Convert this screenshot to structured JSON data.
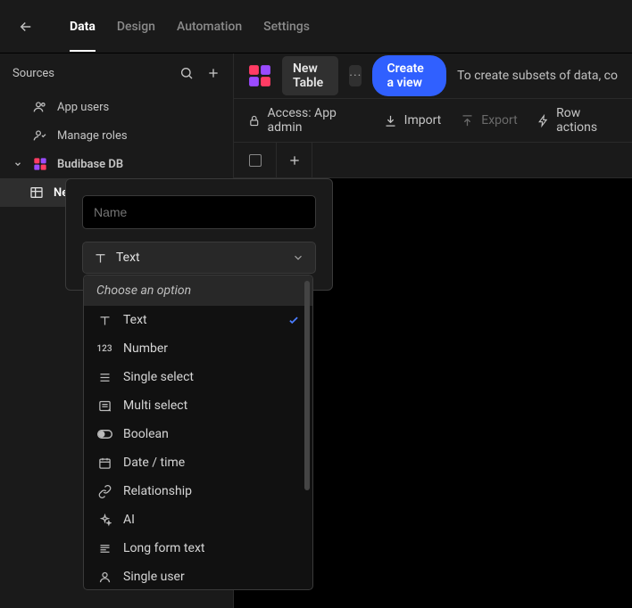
{
  "nav": {
    "tabs": [
      "Data",
      "Design",
      "Automation",
      "Settings"
    ],
    "active": 0
  },
  "sidebar": {
    "title": "Sources",
    "items": {
      "app_users": "App users",
      "manage_roles": "Manage roles",
      "db": "Budibase DB",
      "new_table": "New Table"
    }
  },
  "content": {
    "table_name": "New Table",
    "create_view": "Create a view",
    "hint": "To create subsets of data, co"
  },
  "toolbar": {
    "access": "Access: App admin",
    "import": "Import",
    "export": "Export",
    "row_actions": "Row actions"
  },
  "popover": {
    "name_placeholder": "Name",
    "type_selected": "Text"
  },
  "dropdown": {
    "placeholder": "Choose an option",
    "options": [
      {
        "icon": "text",
        "label": "Text",
        "selected": true
      },
      {
        "icon": "number",
        "label": "Number"
      },
      {
        "icon": "single",
        "label": "Single select"
      },
      {
        "icon": "multi",
        "label": "Multi select"
      },
      {
        "icon": "boolean",
        "label": "Boolean"
      },
      {
        "icon": "date",
        "label": "Date / time"
      },
      {
        "icon": "rel",
        "label": "Relationship"
      },
      {
        "icon": "ai",
        "label": "AI"
      },
      {
        "icon": "long",
        "label": "Long form text"
      },
      {
        "icon": "user",
        "label": "Single user"
      }
    ]
  }
}
